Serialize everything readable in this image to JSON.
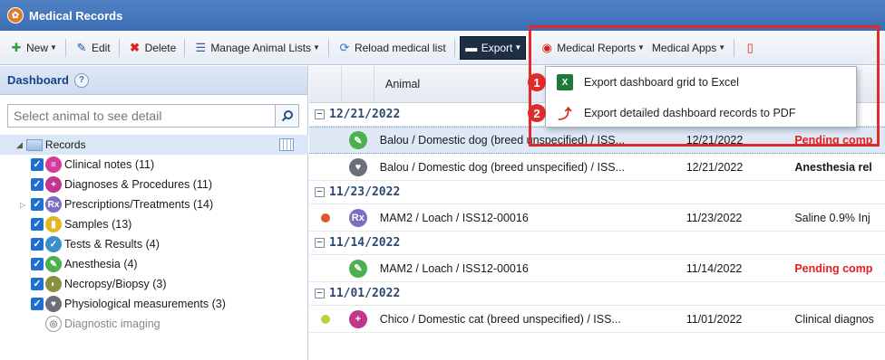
{
  "window": {
    "title": "Medical Records"
  },
  "toolbar": {
    "new_label": "New",
    "edit_label": "Edit",
    "delete_label": "Delete",
    "manage_lists_label": "Manage Animal Lists",
    "reload_label": "Reload medical list",
    "export_label": "Export",
    "medical_reports_label": "Medical Reports",
    "medical_apps_label": "Medical Apps"
  },
  "dashboard": {
    "title": "Dashboard",
    "help_glyph": "?",
    "search_placeholder": "Select animal to see detail"
  },
  "tree": {
    "root_label": "Records",
    "items": [
      {
        "label": "Clinical notes (11)",
        "icon": "clinical-notes-icon",
        "color": "#d83a9a",
        "glyph": "≡"
      },
      {
        "label": "Diagnoses & Procedures (11)",
        "icon": "diagnoses-icon",
        "color": "#c2358c",
        "glyph": "+"
      },
      {
        "label": "Prescriptions/Treatments (14)",
        "icon": "prescription-icon",
        "color": "#7b6fc0",
        "glyph": "Rx"
      },
      {
        "label": "Samples (13)",
        "icon": "samples-icon",
        "color": "#e5b623",
        "glyph": "▮"
      },
      {
        "label": "Tests & Results (4)",
        "icon": "tests-icon",
        "color": "#3a8fc9",
        "glyph": "✓"
      },
      {
        "label": "Anesthesia (4)",
        "icon": "anesthesia-icon",
        "color": "#4caf50",
        "glyph": "✎"
      },
      {
        "label": "Necropsy/Biopsy (3)",
        "icon": "necropsy-icon",
        "color": "#8a8f42",
        "glyph": "◐"
      },
      {
        "label": "Physiological measurements (3)",
        "icon": "physiological-icon",
        "color": "#6b6f7a",
        "glyph": "♥"
      },
      {
        "label": "Diagnostic imaging",
        "icon": "diagnostic-imaging-icon",
        "color": "#999999",
        "glyph": "◎"
      }
    ]
  },
  "grid": {
    "column_animal": "Animal",
    "groups": [
      {
        "date": "12/21/2022",
        "rows": [
          {
            "animal": "Balou / Domestic dog (breed unspecified) / ISS...",
            "date": "12/21/2022",
            "desc": "Pending comp",
            "desc_style": "red",
            "icon": "anesthesia-icon",
            "icon_color": "#4caf50",
            "glyph": "✎",
            "dot_color": "",
            "selected": true
          },
          {
            "animal": "Balou / Domestic dog (breed unspecified) / ISS...",
            "date": "12/21/2022",
            "desc": "Anesthesia rel",
            "desc_style": "bold",
            "icon": "physiological-icon",
            "icon_color": "#6b6f7a",
            "glyph": "♥",
            "dot_color": "",
            "selected": false
          }
        ]
      },
      {
        "date": "11/23/2022",
        "rows": [
          {
            "animal": "MAM2 / Loach / ISS12-00016",
            "date": "11/23/2022",
            "desc": "Saline 0.9% Inj",
            "desc_style": "normal",
            "icon": "prescription-icon",
            "icon_color": "#7b6fc0",
            "glyph": "Rx",
            "dot_color": "#e0562a",
            "selected": false
          }
        ]
      },
      {
        "date": "11/14/2022",
        "rows": [
          {
            "animal": "MAM2 / Loach / ISS12-00016",
            "date": "11/14/2022",
            "desc": "Pending comp",
            "desc_style": "red",
            "icon": "anesthesia-icon",
            "icon_color": "#4caf50",
            "glyph": "✎",
            "dot_color": "",
            "selected": false
          }
        ]
      },
      {
        "date": "11/01/2022",
        "rows": [
          {
            "animal": "Chico / Domestic cat (breed unspecified) / ISS...",
            "date": "11/01/2022",
            "desc": "Clinical diagnos",
            "desc_style": "normal",
            "icon": "diagnoses-icon",
            "icon_color": "#c2358c",
            "glyph": "+",
            "dot_color": "#b5d33b",
            "selected": false
          }
        ]
      }
    ]
  },
  "export_menu": {
    "items": [
      {
        "label": "Export dashboard grid to Excel",
        "icon": "excel-icon",
        "badge": "1"
      },
      {
        "label": "Export detailed dashboard records to PDF",
        "icon": "pdf-icon",
        "badge": "2"
      }
    ]
  },
  "colors": {
    "highlight": "#e02b2b",
    "header_blue": "#3d6eb4",
    "pending_red": "#e02020"
  }
}
